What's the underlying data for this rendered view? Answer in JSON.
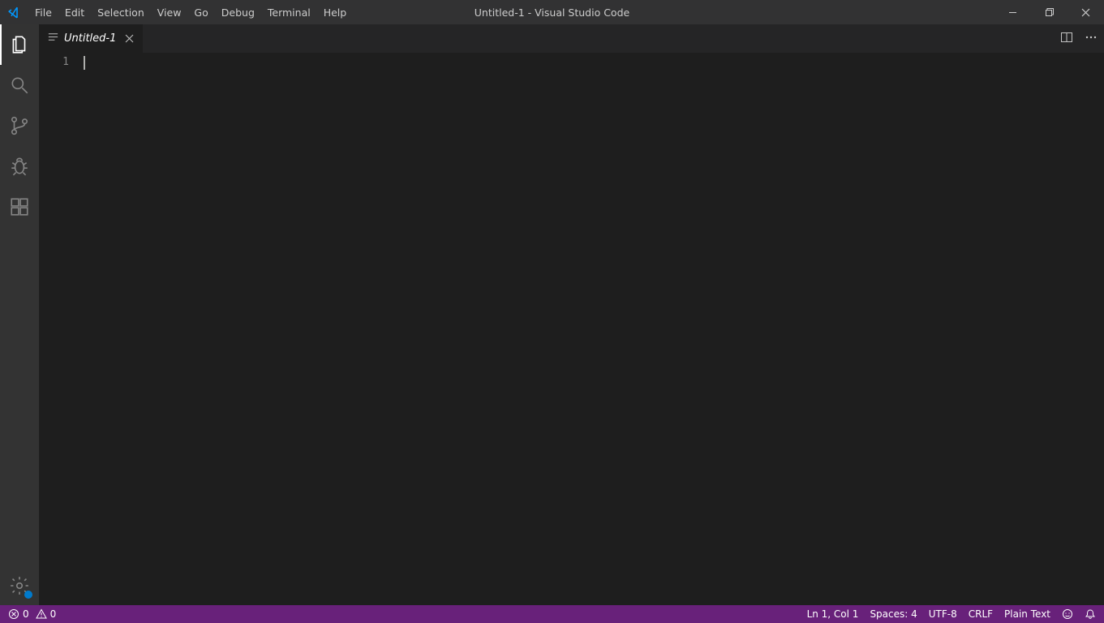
{
  "window": {
    "title": "Untitled-1 - Visual Studio Code"
  },
  "menubar": {
    "items": [
      "File",
      "Edit",
      "Selection",
      "View",
      "Go",
      "Debug",
      "Terminal",
      "Help"
    ]
  },
  "activity_bar": {
    "items": [
      {
        "name": "explorer",
        "active": true
      },
      {
        "name": "search",
        "active": false
      },
      {
        "name": "source-control",
        "active": false
      },
      {
        "name": "debug",
        "active": false
      },
      {
        "name": "extensions",
        "active": false
      }
    ]
  },
  "tabs": [
    {
      "label": "Untitled-1",
      "dirty": false,
      "active": true
    }
  ],
  "editor": {
    "line_numbers": [
      "1"
    ],
    "content": ""
  },
  "status_bar": {
    "errors": "0",
    "warnings": "0",
    "cursor_position": "Ln 1, Col 1",
    "indentation": "Spaces: 4",
    "encoding": "UTF-8",
    "eol": "CRLF",
    "language": "Plain Text"
  },
  "colors": {
    "bg": "#1e1e1e",
    "titlebar": "#323233",
    "activitybar": "#333333",
    "statusbar": "#68217a",
    "accent": "#007acc"
  }
}
